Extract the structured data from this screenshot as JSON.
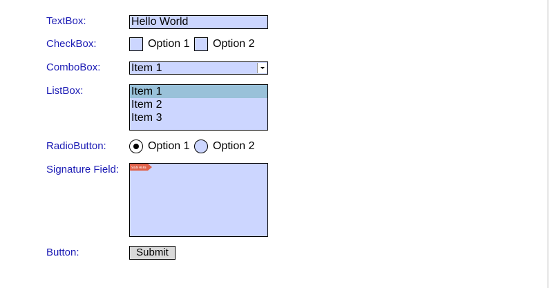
{
  "labels": {
    "textbox": "TextBox:",
    "checkbox": "CheckBox:",
    "combobox": "ComboBox:",
    "listbox": "ListBox:",
    "radiobutton": "RadioButton:",
    "signature": "Signature Field:",
    "button": "Button:"
  },
  "textbox": {
    "value": "Hello World"
  },
  "checkbox": {
    "options": [
      {
        "label": "Option 1",
        "checked": false
      },
      {
        "label": "Option 2",
        "checked": false
      }
    ]
  },
  "combobox": {
    "selected": "Item 1"
  },
  "listbox": {
    "items": [
      "Item 1",
      "Item 2",
      "Item 3"
    ],
    "selected_index": 0
  },
  "radio": {
    "options": [
      {
        "label": "Option 1",
        "selected": true
      },
      {
        "label": "Option 2",
        "selected": false
      }
    ]
  },
  "signature": {
    "flag_text": "SIGN HERE"
  },
  "button": {
    "label": "Submit"
  },
  "colors": {
    "label_text": "#1a1ab4",
    "field_background": "#ccd6ff",
    "list_selection": "#99c1d9",
    "button_background": "#d9d9d9",
    "signature_flag": "#e0614a"
  },
  "icons": {
    "combo_dropdown": "chevron-down-icon",
    "signature_flag": "sign-here-flag-icon",
    "radio_selected": "radio-selected-icon"
  }
}
